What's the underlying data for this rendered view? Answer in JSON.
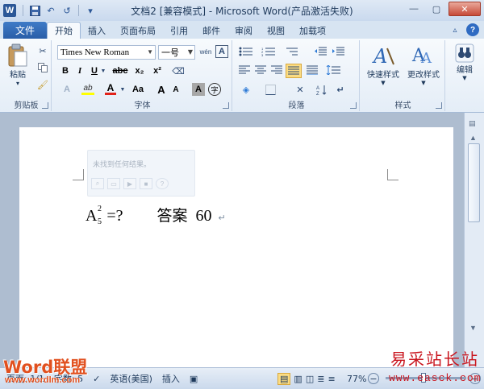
{
  "window": {
    "title": "文档2 [兼容模式] - Microsoft Word(产品激活失败)",
    "logo_letter": "W",
    "controls": {
      "minimize": "—",
      "maximize": "▢",
      "close": "✕"
    }
  },
  "qat": {
    "save": "💾",
    "undo": "↶",
    "redo": "↺",
    "more": "▾"
  },
  "tabs": {
    "file": "文件",
    "items": [
      "开始",
      "插入",
      "页面布局",
      "引用",
      "邮件",
      "审阅",
      "视图",
      "加载项"
    ],
    "active": "开始",
    "minimize_ribbon": "▵",
    "help": "?"
  },
  "ribbon": {
    "clipboard": {
      "label": "剪贴板",
      "paste": "粘贴",
      "paste_arrow": "▾"
    },
    "font": {
      "label": "字体",
      "font_name": "Times New Roman",
      "font_size": "一号",
      "bold": "B",
      "italic": "I",
      "underline": "U",
      "strikethrough": "abc",
      "subscript": "x₂",
      "superscript": "x²",
      "grow": "A",
      "shrink": "A",
      "case": "Aa",
      "font_color": "A",
      "highlight": "ab",
      "char_shading": "A",
      "enclose": "字",
      "phonetic": "wén",
      "char_border": "A"
    },
    "paragraph": {
      "label": "段落"
    },
    "styles": {
      "label": "样式",
      "quick_styles": "快速样式",
      "change_styles": "更改样式"
    },
    "editing": {
      "label": "编辑"
    }
  },
  "findbox": {
    "placeholder": "未找到任何结果。"
  },
  "document": {
    "eq_base": "A",
    "eq_sup": "2",
    "eq_sub": "5",
    "eq_rest": "=?",
    "answer_label": "答案",
    "answer_value": "60",
    "para_mark": "↵"
  },
  "status": {
    "page": "页面: 1/1",
    "words": "字数: 5",
    "language": "英语(美国)",
    "insert_mode": "插入",
    "zoom": "77%",
    "zoom_minus": "−",
    "zoom_plus": "+"
  },
  "watermarks": {
    "left": "Word联盟",
    "left_url": "www.wordlm.com",
    "right": "易采站长站",
    "right_url": "www.easck.com"
  },
  "colors": {
    "file_tab": "#2a5ea8",
    "accent": "#2b5797",
    "watermark_left": "#e1501f",
    "watermark_right": "#c9151e"
  }
}
